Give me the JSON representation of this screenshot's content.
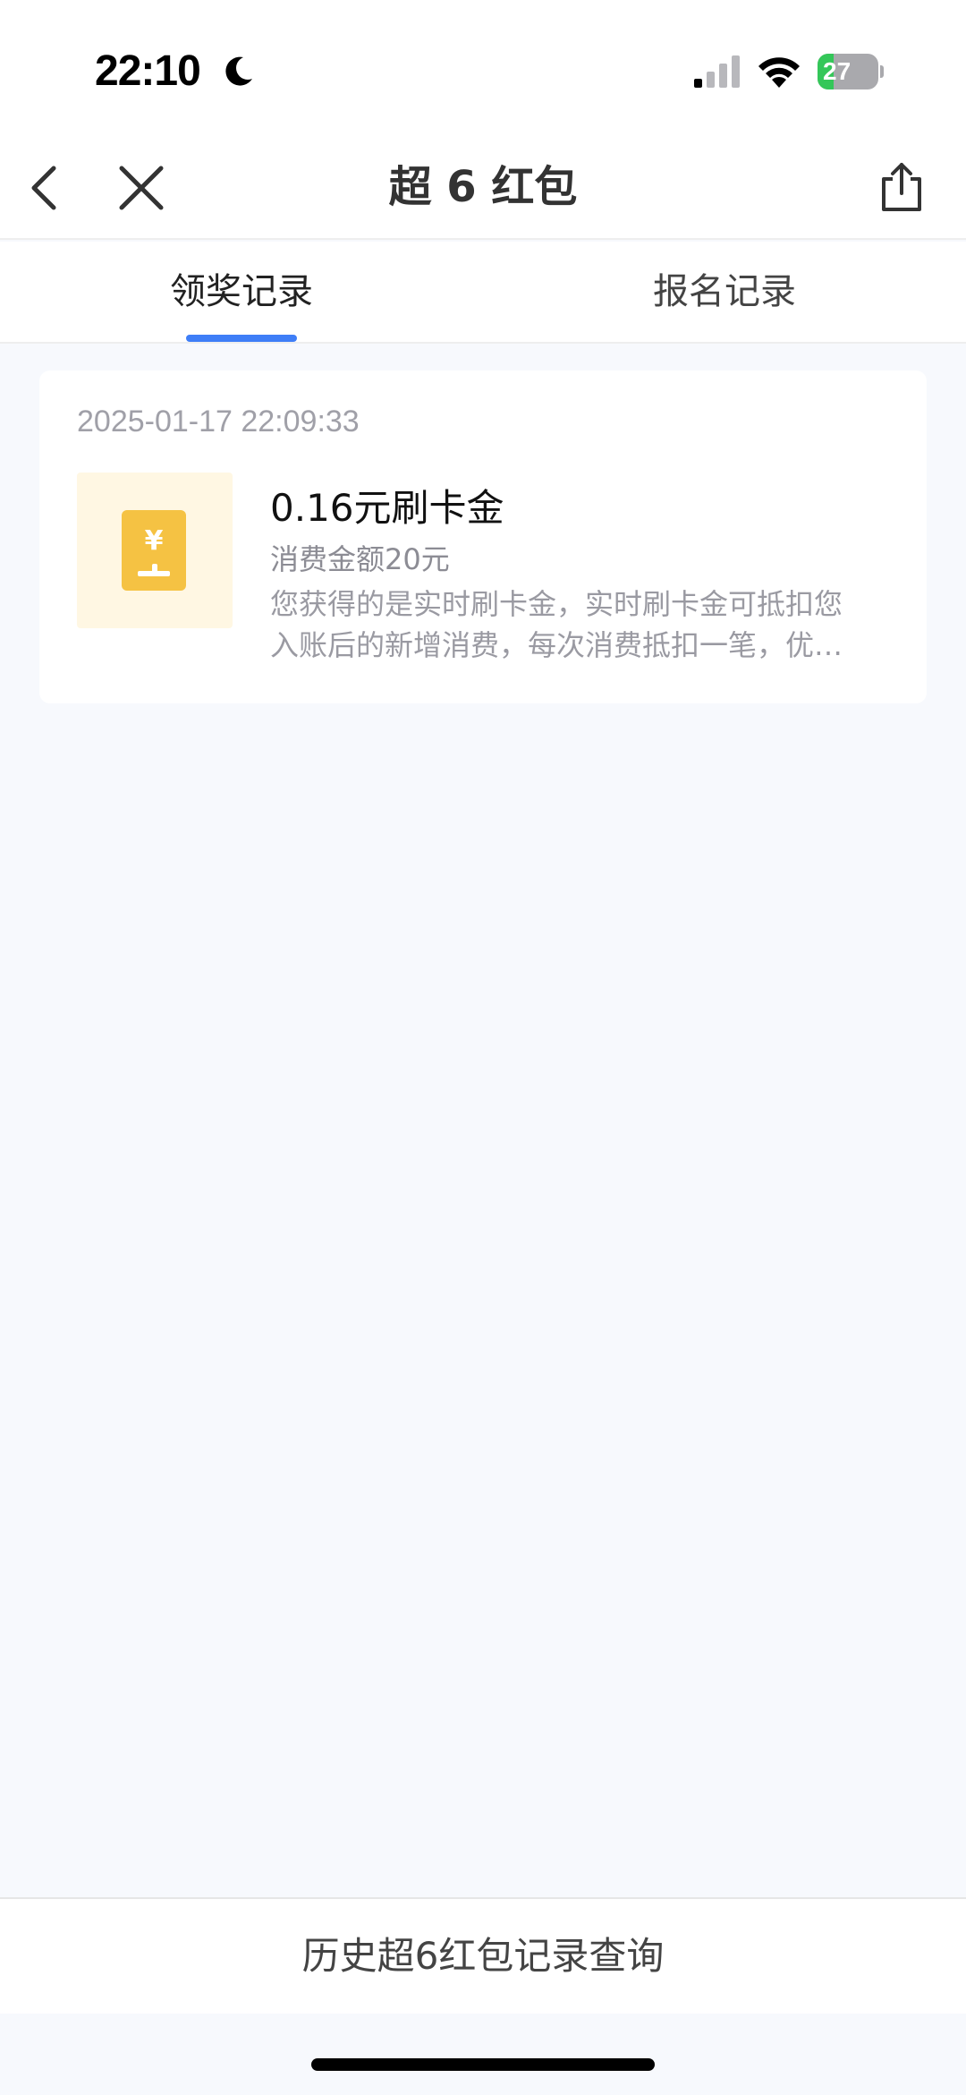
{
  "status_bar": {
    "time": "22:10",
    "battery": "27",
    "battery_level": 0.27
  },
  "nav": {
    "title": "超 6 红包"
  },
  "tabs": [
    {
      "label": "领奖记录",
      "active": true
    },
    {
      "label": "报名记录",
      "active": false
    }
  ],
  "records": [
    {
      "date": "2025-01-17 22:09:33",
      "title": "0.16元刷卡金",
      "spend": "消费金额20元",
      "description_line1": "您获得的是实时刷卡金，实时刷卡金可抵扣您",
      "description_line2": "入账后的新增消费，每次消费抵扣一笔，优…",
      "icon_symbol": "¥"
    }
  ],
  "footer": {
    "history_link": "历史超6红包记录查询"
  },
  "colors": {
    "accent": "#3e7ef7",
    "coupon_bg": "#fff7e3",
    "coupon_icon": "#f5c243",
    "battery_fill": "#34c759"
  }
}
